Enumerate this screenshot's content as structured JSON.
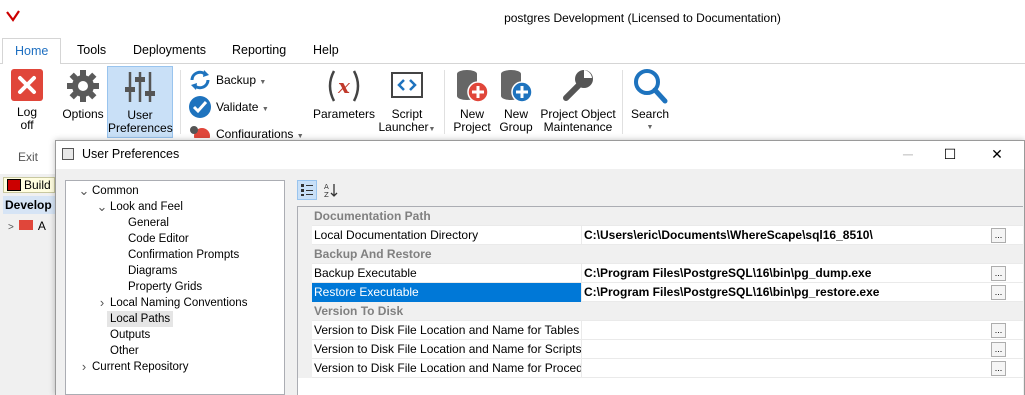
{
  "window": {
    "title": "postgres  Development  (Licensed to Documentation)"
  },
  "ribbon_tabs": [
    {
      "label": "Home"
    },
    {
      "label": "Tools"
    },
    {
      "label": "Deployments"
    },
    {
      "label": "Reporting"
    },
    {
      "label": "Help"
    }
  ],
  "ribbon": {
    "logoff": {
      "line1": "Log",
      "line2": "off"
    },
    "options": {
      "label": "Options"
    },
    "user_prefs": {
      "line1": "User",
      "line2": "Preferences"
    },
    "backup": {
      "label": "Backup"
    },
    "validate": {
      "label": "Validate"
    },
    "configurations": {
      "label": "Configurations"
    },
    "parameters": {
      "label": "Parameters"
    },
    "script_launcher": {
      "line1": "Script",
      "line2": "Launcher"
    },
    "new_project": {
      "line1": "New",
      "line2": "Project"
    },
    "new_group": {
      "line1": "New",
      "line2": "Group"
    },
    "project_object_maintenance": {
      "line1": "Project Object",
      "line2": "Maintenance"
    },
    "search": {
      "label": "Search"
    },
    "exit_label": "Exit"
  },
  "background_panel": {
    "build_label": "Build",
    "develop_label": "Develop",
    "tree_item": "A"
  },
  "dialog": {
    "title": "User Preferences",
    "tree": [
      {
        "label": "Common",
        "level": 0,
        "expander": "v"
      },
      {
        "label": "Look and Feel",
        "level": 1,
        "expander": "v"
      },
      {
        "label": "General",
        "level": 2,
        "expander": ""
      },
      {
        "label": "Code Editor",
        "level": 2,
        "expander": ""
      },
      {
        "label": "Confirmation Prompts",
        "level": 2,
        "expander": ""
      },
      {
        "label": "Diagrams",
        "level": 2,
        "expander": ""
      },
      {
        "label": "Property Grids",
        "level": 2,
        "expander": ""
      },
      {
        "label": "Local Naming Conventions",
        "level": 1,
        "expander": ">"
      },
      {
        "label": "Local Paths",
        "level": 1,
        "expander": "",
        "selected": true
      },
      {
        "label": "Outputs",
        "level": 1,
        "expander": ""
      },
      {
        "label": "Other",
        "level": 1,
        "expander": ""
      },
      {
        "label": "Current Repository",
        "level": 0,
        "expander": ">"
      }
    ],
    "grid": {
      "rows": [
        {
          "kind": "category",
          "name": "Documentation Path"
        },
        {
          "kind": "prop",
          "name": "Local Documentation Directory",
          "value": "C:\\Users\\eric\\Documents\\WhereScape\\sql16_8510\\"
        },
        {
          "kind": "category",
          "name": "Backup And Restore"
        },
        {
          "kind": "prop",
          "name": "Backup Executable",
          "value": "C:\\Program Files\\PostgreSQL\\16\\bin\\pg_dump.exe"
        },
        {
          "kind": "prop",
          "name": "Restore Executable",
          "value": "C:\\Program Files\\PostgreSQL\\16\\bin\\pg_restore.exe",
          "selected": true
        },
        {
          "kind": "category",
          "name": "Version To Disk"
        },
        {
          "kind": "prop",
          "name": "Version to Disk File Location and Name for Tables",
          "value": ""
        },
        {
          "kind": "prop",
          "name": "Version to Disk File Location and Name for Scripts",
          "value": ""
        },
        {
          "kind": "prop",
          "name": "Version to Disk File Location and Name for Procedures",
          "value": ""
        }
      ],
      "ellipsis": "..."
    }
  }
}
